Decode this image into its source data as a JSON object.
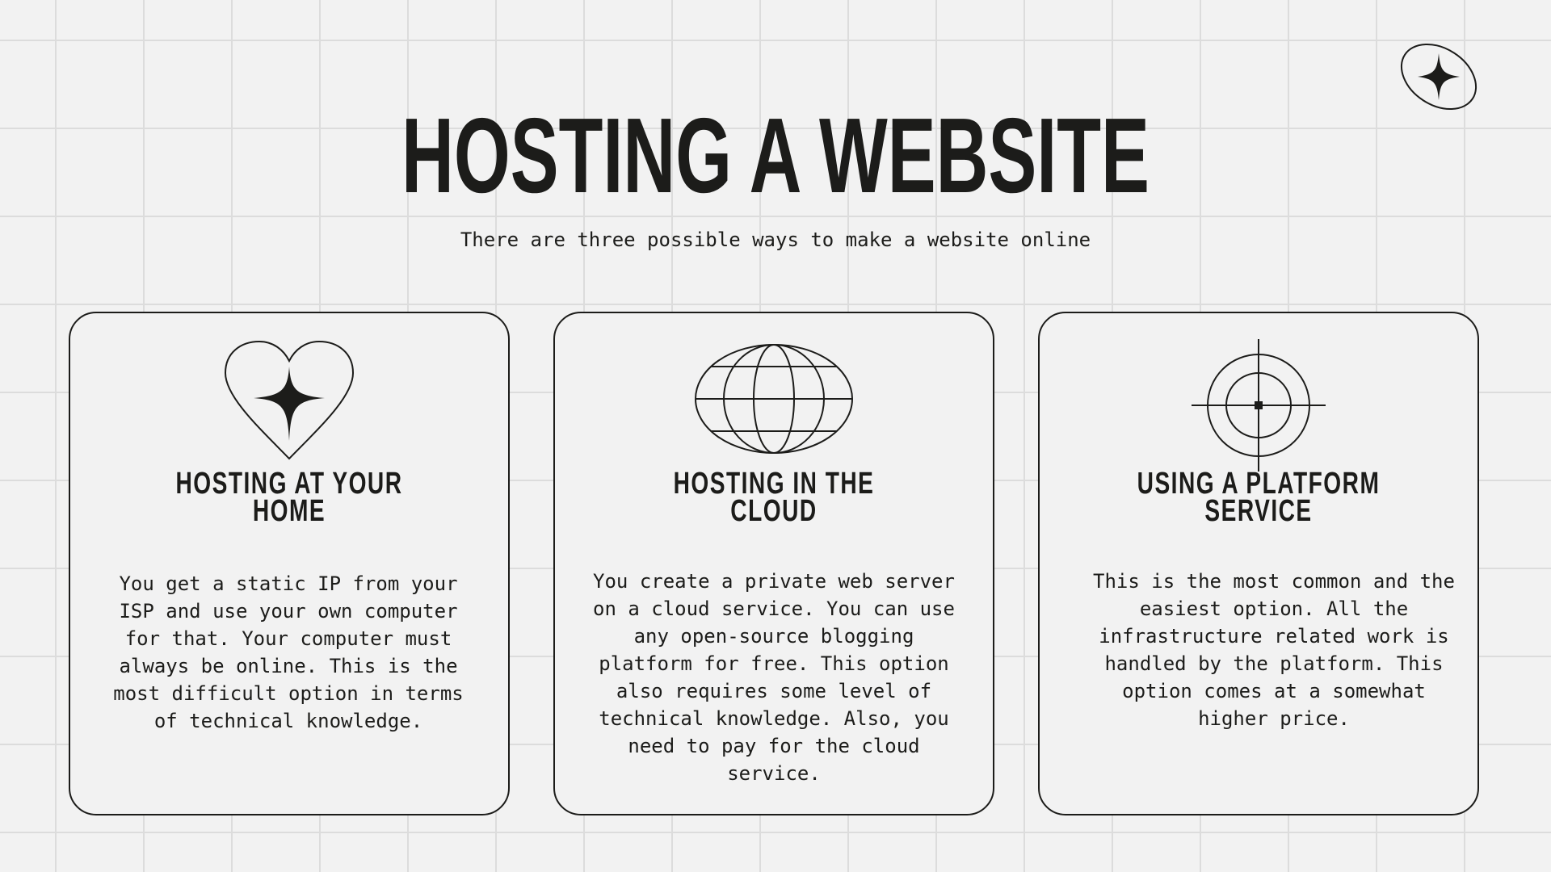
{
  "page": {
    "title": "HOSTING A WEBSITE",
    "subtitle": "There are three possible ways to make a website online"
  },
  "icons": {
    "corner": "sparkle-in-ellipse-icon",
    "card1": "heart-sparkle-icon",
    "card2": "globe-icon",
    "card3": "crosshair-target-icon"
  },
  "colors": {
    "background": "#f2f2f2",
    "grid": "#dcdcdc",
    "ink": "#1c1c1a"
  },
  "cards": [
    {
      "title_line1": "HOSTING AT YOUR",
      "title_line2": "HOME",
      "text": "You get a static IP from your ISP and use your own computer for that. Your computer must always be online. This is the most difficult option in terms of technical knowledge."
    },
    {
      "title_line1": "HOSTING IN THE",
      "title_line2": "CLOUD",
      "text": "You create a private web server on a cloud service. You can use any open-source blogging platform for free. This option also requires some level of technical knowledge. Also, you need to pay for the cloud service."
    },
    {
      "title_line1": "USING A PLATFORM",
      "title_line2": "SERVICE",
      "text": "This is the most common and the easiest option. All the infrastructure related work is handled by the platform. This option comes at a somewhat higher price."
    }
  ]
}
